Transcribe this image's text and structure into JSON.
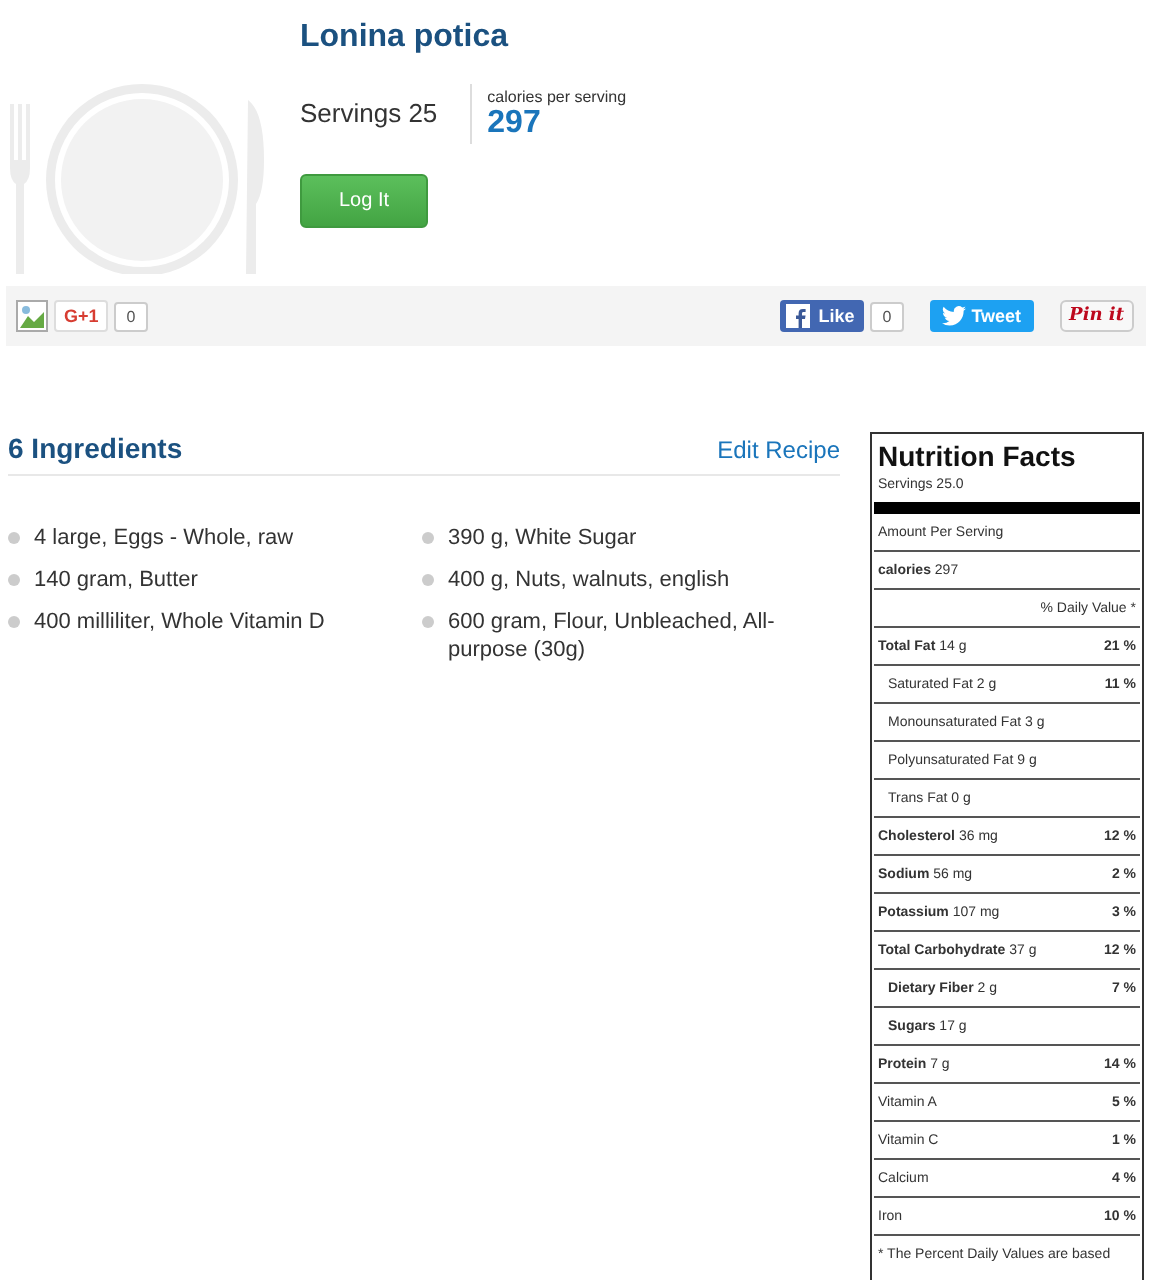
{
  "recipe": {
    "title": "Lonina potica",
    "servings": "Servings 25",
    "calories_label": "calories per serving",
    "calories": "297",
    "log_button": "Log It"
  },
  "social": {
    "gplus": "G+1",
    "gplus_count": "0",
    "like": "Like",
    "like_count": "0",
    "tweet": "Tweet",
    "pin": "Pin it"
  },
  "ingredients": {
    "heading": "6 Ingredients",
    "edit_link": "Edit Recipe",
    "items": [
      {
        "text": "4 large, Eggs - Whole, raw"
      },
      {
        "text": "140 gram, Butter"
      },
      {
        "text": "400 milliliter, Whole Vitamin D"
      },
      {
        "text": "390 g, White Sugar"
      },
      {
        "text": "400 g, Nuts, walnuts, english"
      },
      {
        "text": "600 gram, Flour, Unbleached, All-purpose (30g)"
      }
    ]
  },
  "nutrition": {
    "title": "Nutrition Facts",
    "servings": "Servings 25.0",
    "amount_per": "Amount Per Serving",
    "calories_name": "calories",
    "calories": "297",
    "dv_header": "% Daily Value *",
    "rows": [
      {
        "kind": "main",
        "name": "Total Fat",
        "amount": "14 g",
        "dv": "21 %"
      },
      {
        "kind": "sub",
        "name": "Saturated Fat",
        "amount": "2 g",
        "dv": "11 %"
      },
      {
        "kind": "sub",
        "name": "Monounsaturated Fat",
        "amount": "3 g"
      },
      {
        "kind": "sub",
        "name": "Polyunsaturated Fat",
        "amount": "9 g"
      },
      {
        "kind": "sub",
        "name": "Trans Fat",
        "amount": "0 g"
      },
      {
        "kind": "main",
        "name": "Cholesterol",
        "amount": "36 mg",
        "dv": "12 %"
      },
      {
        "kind": "main",
        "name": "Sodium",
        "amount": "56 mg",
        "dv": "2 %"
      },
      {
        "kind": "main",
        "name": "Potassium",
        "amount": "107 mg",
        "dv": "3 %"
      },
      {
        "kind": "main",
        "name": "Total Carbohydrate",
        "amount": "37 g",
        "dv": "12 %"
      },
      {
        "kind": "subbold",
        "name": "Dietary Fiber",
        "amount": "2 g",
        "dv": "7 %"
      },
      {
        "kind": "subbold",
        "name": "Sugars",
        "amount": "17 g"
      },
      {
        "kind": "main",
        "name": "Protein",
        "amount": "7 g",
        "dv": "14 %"
      },
      {
        "kind": "plain",
        "name": "Vitamin A",
        "dv": "5 %"
      },
      {
        "kind": "plain",
        "name": "Vitamin C",
        "dv": "1 %"
      },
      {
        "kind": "plain",
        "name": "Calcium",
        "dv": "4 %"
      },
      {
        "kind": "plain",
        "name": "Iron",
        "dv": "10 %"
      }
    ],
    "footnote": "* The Percent Daily Values are based"
  }
}
